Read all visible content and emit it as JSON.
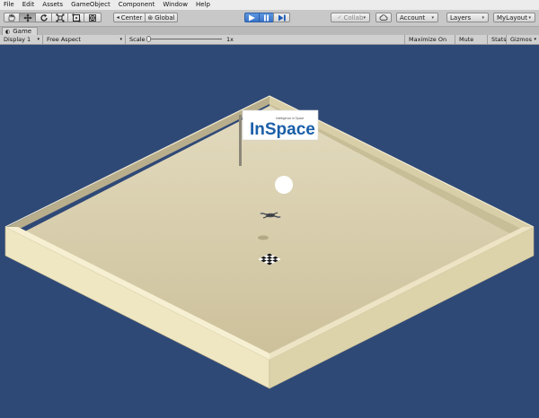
{
  "menubar": {
    "items": [
      "File",
      "Edit",
      "Assets",
      "GameObject",
      "Component",
      "Window",
      "Help"
    ]
  },
  "toolbar": {
    "tools": [
      "hand-tool-icon",
      "move-tool-icon",
      "rotate-tool-icon",
      "scale-tool-icon",
      "rect-tool-icon",
      "transform-tool-icon"
    ],
    "pivot_label": "Center",
    "space_label": "Global",
    "collab_label": "Collab",
    "account_label": "Account",
    "layers_label": "Layers",
    "layout_label": "MyLayout",
    "dropdown_glyph": "▾",
    "colors": {
      "play_active": "#3a74c8",
      "toolbar_bg": "#c8c8c8"
    }
  },
  "game_tab": {
    "title": "Game"
  },
  "game_bar": {
    "display": "Display 1",
    "aspect": "Free Aspect",
    "scale_label": "Scale",
    "scale_value": "1x",
    "maximize": "Maximize On Play",
    "mute": "Mute Audio",
    "stats": "Stats",
    "gizmos": "Gizmos"
  },
  "scene": {
    "sign_title": "InSpace",
    "sign_subtitle": "Intelligence in Space",
    "background_color": "#2f4977",
    "floor_color": "#d9ceaa"
  }
}
